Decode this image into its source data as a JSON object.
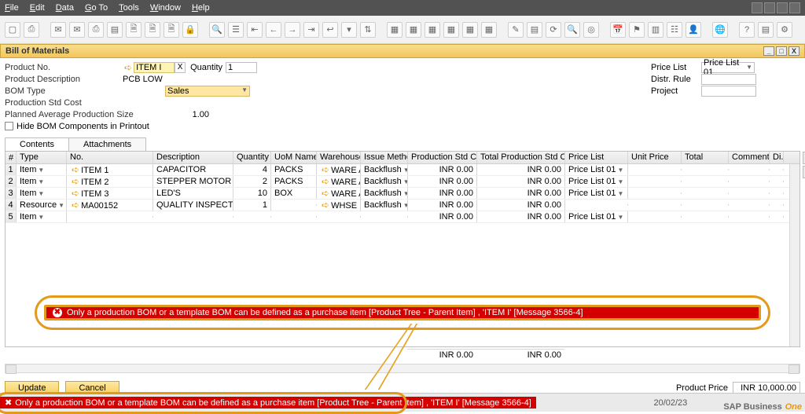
{
  "menubar": {
    "items": [
      "File",
      "Edit",
      "Data",
      "Go To",
      "Tools",
      "Window",
      "Help"
    ]
  },
  "toolbar": {
    "icons": [
      "doc-new-icon",
      "print-icon",
      "mail-icon",
      "mail-send-icon",
      "printer-icon",
      "print-preview-icon",
      "page-icon",
      "export-icon",
      "excel-icon",
      "lock-icon",
      "search-icon",
      "list-icon",
      "nav-first-icon",
      "nav-prev-icon",
      "nav-next-icon",
      "nav-last-icon",
      "reply-icon",
      "filter-icon",
      "sort-icon",
      "",
      "layout-a-icon",
      "layout-b-icon",
      "layout-c-icon",
      "layout-d-icon",
      "layout-e-icon",
      "layout-f-icon",
      "",
      "edit-icon",
      "form-settings-icon",
      "refresh-icon",
      "find-icon",
      "target-icon",
      "",
      "calendar-icon",
      "alert-icon",
      "chart-icon",
      "tree-icon",
      "user-icon",
      "",
      "globe-icon",
      "",
      "help-icon",
      "wizard-icon",
      "settings-icon"
    ]
  },
  "window": {
    "title": "Bill of Materials",
    "controls": {
      "minimize": "_",
      "maximize": "□",
      "close": "X"
    }
  },
  "header": {
    "productNo_label": "Product No.",
    "productNo_value": "ITEM I",
    "x_btn": "X",
    "quantity_label": "Quantity",
    "quantity_value": "1",
    "productDesc_label": "Product Description",
    "productDesc_value": "PCB LOW",
    "bomType_label": "BOM Type",
    "bomType_value": "Sales",
    "prodStdCost_label": "Production Std Cost",
    "plannedAvg_label": "Planned Average Production Size",
    "plannedAvg_value": "1.00",
    "hideBOM_label": "Hide BOM Components in Printout",
    "priceList_label": "Price List",
    "priceList_value": "Price List 01",
    "distrRule_label": "Distr. Rule",
    "project_label": "Project"
  },
  "tabs": {
    "contents": "Contents",
    "attachments": "Attachments"
  },
  "grid": {
    "columns": {
      "num": "#",
      "type": "Type",
      "no": "No.",
      "desc": "Description",
      "qty": "Quantity",
      "uom": "UoM Name",
      "ware": "Warehouse",
      "iss": "Issue Method",
      "psc": "Production Std Cost",
      "tpsc": "Total Production Std Cost",
      "pl": "Price List",
      "uprice": "Unit Price",
      "total": "Total",
      "comm": "Comments",
      "di": "Di..."
    },
    "rows": [
      {
        "n": "1",
        "type": "Item",
        "no": "ITEM 1",
        "desc": "CAPACITOR",
        "qty": "4",
        "uom": "PACKS",
        "ware": "WARE A",
        "iss": "Backflush",
        "psc": "INR 0.00",
        "tpsc": "INR 0.00",
        "pl": "Price List 01"
      },
      {
        "n": "2",
        "type": "Item",
        "no": "ITEM 2",
        "desc": "STEPPER MOTOR",
        "qty": "2",
        "uom": "PACKS",
        "ware": "WARE A",
        "iss": "Backflush",
        "psc": "INR 0.00",
        "tpsc": "INR 0.00",
        "pl": "Price List 01"
      },
      {
        "n": "3",
        "type": "Item",
        "no": "ITEM 3",
        "desc": "LED'S",
        "qty": "10",
        "uom": "BOX",
        "ware": "WARE A",
        "iss": "Backflush",
        "psc": "INR 0.00",
        "tpsc": "INR 0.00",
        "pl": "Price List 01"
      },
      {
        "n": "4",
        "type": "Resource",
        "no": "MA00152",
        "desc": "QUALITY INSPECTOR",
        "qty": "1",
        "uom": "",
        "ware": "WHSE D",
        "iss": "Backflush",
        "psc": "INR 0.00",
        "tpsc": "INR 0.00",
        "pl": ""
      },
      {
        "n": "5",
        "type": "Item",
        "no": "",
        "desc": "",
        "qty": "",
        "uom": "",
        "ware": "",
        "iss": "",
        "psc": "INR 0.00",
        "tpsc": "INR 0.00",
        "pl": "Price List 01"
      }
    ],
    "total_row": {
      "psc": "INR 0.00",
      "tpsc": "INR 0.00"
    }
  },
  "error": {
    "text": "Only a production BOM or a template BOM can be defined as a purchase item [Product Tree - Parent Item] , 'ITEM I'  [Message 3566-4]"
  },
  "footer": {
    "update": "Update",
    "cancel": "Cancel",
    "productPrice_label": "Product Price",
    "productPrice_value": "INR 10,000.00"
  },
  "statusbar": {
    "error": "Only a production BOM or a template BOM can be defined as a purchase item [Product Tree - Parent Item] , 'ITEM I'  [Message 3566-4]",
    "date": "20/02/23",
    "brand": "SAP Business",
    "brand2": "One"
  }
}
